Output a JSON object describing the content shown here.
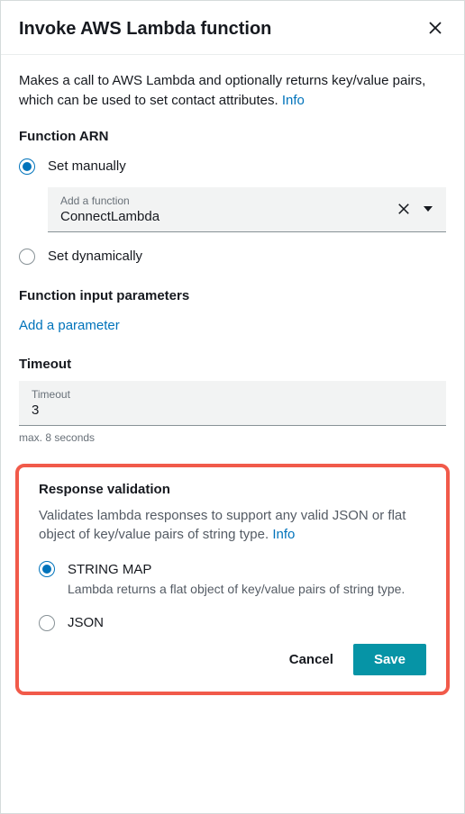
{
  "header": {
    "title": "Invoke AWS Lambda function"
  },
  "description": {
    "text": "Makes a call to AWS Lambda and optionally returns key/value pairs, which can be used to set contact attributes. ",
    "info_label": "Info"
  },
  "function_arn": {
    "label": "Function ARN",
    "set_manually_label": "Set manually",
    "set_dynamically_label": "Set dynamically",
    "select_placeholder": "Add a function",
    "select_value": "ConnectLambda"
  },
  "input_params": {
    "label": "Function input parameters",
    "add_label": "Add a parameter"
  },
  "timeout": {
    "section_label": "Timeout",
    "field_label": "Timeout",
    "value": "3",
    "hint": "max. 8 seconds"
  },
  "response_validation": {
    "label": "Response validation",
    "desc": "Validates lambda responses to support any valid JSON or flat object of key/value pairs of string type. ",
    "info_label": "Info",
    "string_map_label": "STRING MAP",
    "string_map_desc": "Lambda returns a flat object of key/value pairs of string type.",
    "json_label": "JSON"
  },
  "footer": {
    "cancel_label": "Cancel",
    "save_label": "Save"
  }
}
